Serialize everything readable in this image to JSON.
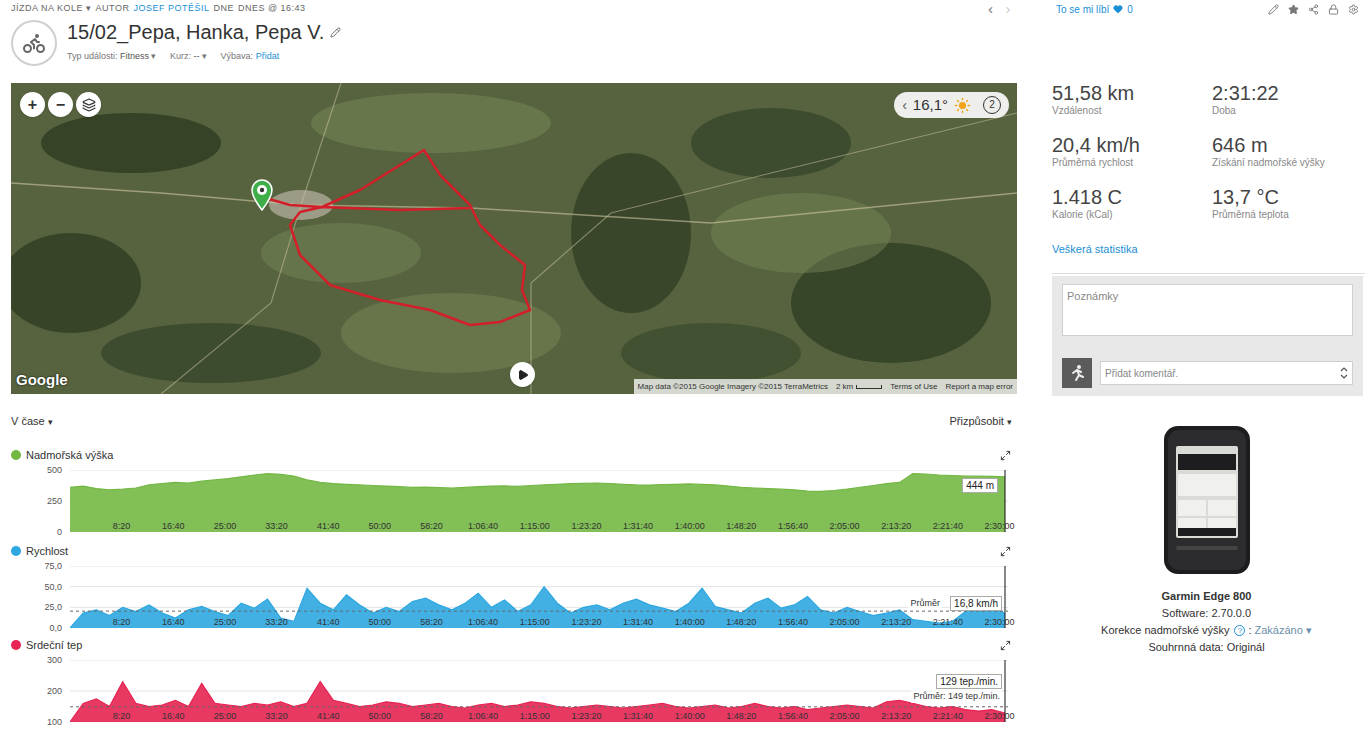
{
  "header": {
    "activity_type": "JÍZDA NA KOLE",
    "activity_caret": "▾",
    "author_prefix": "AUTOR",
    "author": "JOSEF POTĚŠIL",
    "date_prefix": "DNE",
    "date": "DNES @ 16:43",
    "prev": "‹",
    "next": "›"
  },
  "like": {
    "label": "To se mi líbí",
    "count": "0"
  },
  "title": "15/02_Pepa, Hanka, Pepa V.",
  "meta": [
    {
      "label": "Typ události:",
      "value": "Fitness",
      "caret": "▾",
      "link": false
    },
    {
      "label": "Kurz:",
      "value": "--",
      "caret": "▾",
      "link": false
    },
    {
      "label": "Výbava:",
      "value": "Přidat",
      "caret": "",
      "link": true
    }
  ],
  "map": {
    "zoom_in": "+",
    "zoom_out": "−",
    "weather": {
      "prev": "‹",
      "temperature": "16,1°",
      "badge": "2"
    },
    "logo": "Google",
    "attribution": "Map data ©2015 Google Imagery ©2015 TerraMetrics",
    "scale": "2 km",
    "terms": "Terms of Use",
    "report": "Report a map error"
  },
  "charts_header": {
    "mode": "V čase",
    "mode_caret": "▾",
    "customize": "Přizpůsobit",
    "customize_caret": "▾"
  },
  "x_ticks": [
    "8:20",
    "16:40",
    "25:00",
    "33:20",
    "41:40",
    "50:00",
    "58:20",
    "1:06:40",
    "1:15:00",
    "1:23:20",
    "1:31:40",
    "1:40:00",
    "1:48:20",
    "1:56:40",
    "2:05:00",
    "2:13:20",
    "2:21:40",
    "2:30:00"
  ],
  "charts": [
    {
      "name": "Nadmořská výška",
      "color": "#74b844",
      "y_ticks": [
        "500",
        "250",
        "0"
      ],
      "min": 0,
      "max": 500,
      "tooltip": "444 m",
      "values": [
        360,
        370,
        350,
        340,
        345,
        355,
        380,
        390,
        400,
        395,
        410,
        420,
        430,
        445,
        460,
        470,
        465,
        450,
        420,
        400,
        390,
        385,
        380,
        375,
        370,
        365,
        360,
        362,
        358,
        355,
        360,
        365,
        370,
        372,
        368,
        375,
        380,
        385,
        390,
        392,
        395,
        390,
        385,
        380,
        378,
        382,
        385,
        388,
        384,
        380,
        370,
        360,
        355,
        350,
        345,
        340,
        330,
        328,
        335,
        345,
        360,
        375,
        390,
        400,
        470,
        468,
        460,
        455,
        452,
        450,
        448,
        444
      ]
    },
    {
      "name": "Rychlost",
      "color": "#2ea7e0",
      "y_ticks": [
        "75,0",
        "50,0",
        "25,0",
        "0,0"
      ],
      "min": 0,
      "max": 75,
      "tooltip": "16,8 km/h",
      "average": {
        "value": 20.4,
        "label": "Průměr"
      },
      "values": [
        0,
        18,
        22,
        15,
        25,
        20,
        28,
        18,
        12,
        22,
        26,
        20,
        15,
        30,
        24,
        35,
        12,
        8,
        48,
        30,
        22,
        40,
        28,
        18,
        25,
        20,
        32,
        36,
        28,
        22,
        30,
        42,
        25,
        34,
        20,
        28,
        50,
        30,
        18,
        25,
        28,
        22,
        30,
        35,
        28,
        24,
        20,
        30,
        48,
        26,
        22,
        18,
        30,
        36,
        24,
        28,
        38,
        22,
        18,
        25,
        20,
        15,
        18,
        22,
        10,
        8,
        6,
        8,
        20,
        35,
        30,
        17
      ]
    },
    {
      "name": "Srdeční tep",
      "color": "#e62352",
      "y_ticks": [
        "300",
        "200",
        "100"
      ],
      "min": 100,
      "max": 300,
      "tooltip": "129 tep./min.",
      "average": {
        "value": 149,
        "label": "Průměr: 149 tep./min."
      },
      "values": [
        100,
        160,
        175,
        150,
        230,
        160,
        150,
        155,
        170,
        150,
        225,
        160,
        155,
        150,
        160,
        155,
        165,
        150,
        160,
        230,
        170,
        160,
        150,
        155,
        165,
        160,
        150,
        155,
        160,
        150,
        145,
        155,
        160,
        150,
        155,
        165,
        160,
        150,
        145,
        150,
        155,
        150,
        145,
        150,
        155,
        160,
        150,
        145,
        150,
        155,
        145,
        150,
        160,
        150,
        145,
        150,
        140,
        145,
        150,
        155,
        150,
        145,
        165,
        170,
        160,
        150,
        145,
        150,
        140,
        135,
        140,
        129
      ]
    }
  ],
  "stats": [
    {
      "value": "51,58 km",
      "label": "Vzdálenost"
    },
    {
      "value": "2:31:22",
      "label": "Doba"
    },
    {
      "value": "20,4 km/h",
      "label": "Průměrná rychlost"
    },
    {
      "value": "646 m",
      "label": "Získání nadmořské výšky"
    },
    {
      "value": "1.418 C",
      "label": "Kalorie (kCal)"
    },
    {
      "value": "13,7 °C",
      "label": "Průměrná teplota"
    }
  ],
  "all_stats_link": "Veškerá statistika",
  "notes": {
    "placeholder": "Poznámky"
  },
  "comment": {
    "placeholder": "Přidat komentář."
  },
  "device": {
    "name": "Garmin Edge 800",
    "software": "Software: 2.70.0.0",
    "correction": {
      "label": "Korekce nadmořské výšky",
      "help": "?",
      "separator": ":",
      "value": "Zakázáno",
      "caret": "▾"
    },
    "summary": "Souhrnná data: Originál"
  }
}
